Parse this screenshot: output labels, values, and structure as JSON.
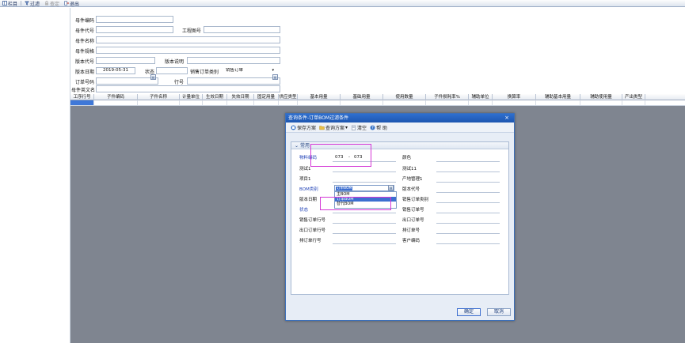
{
  "toolbar": {
    "items": [
      {
        "label": "栏目",
        "icon": "columns-icon"
      },
      {
        "label": "过滤",
        "icon": "filter-icon"
      },
      {
        "label": "查定",
        "icon": "lock-icon",
        "disabled": true
      },
      {
        "label": "退出",
        "icon": "exit-icon"
      }
    ]
  },
  "form": {
    "parent_code_label": "母件编码",
    "parent_alias_label": "母件代号",
    "drawing_no_label": "工程图号",
    "parent_name_label": "母件名称",
    "parent_spec_label": "母件规格",
    "version_code_label": "版本代号",
    "version_desc_label": "版本说明",
    "version_date_label": "版本日期",
    "version_date_value": "2019-05-31",
    "status_label": "状态",
    "sales_order_type_label": "销售订单类别",
    "sales_order_type_value": "销售订单",
    "order_no_label": "订单号码",
    "line_no_label": "行号",
    "parent_en_name_label": "母件英文名"
  },
  "grid": {
    "columns": [
      "工序行号",
      "子件编码",
      "子件名称",
      "计量单位",
      "生效日期",
      "失效日期",
      "固定用量",
      "供应类型",
      "基本用量",
      "基础用量",
      "使用数量",
      "子件损耗率%",
      "辅助单位",
      "换算率",
      "辅助基本用量",
      "辅助使用量",
      "产出类型"
    ]
  },
  "dialog": {
    "title": "查询条件-订单BOM过滤条件",
    "close": "×",
    "toolbar": {
      "save_scheme": "保存方案",
      "query_scheme": "查询方案",
      "clear": "清空",
      "help": "帮 助"
    },
    "section": "常用",
    "fields": {
      "material_code_label": "物料编码",
      "material_code_from": "073",
      "range_sep": "-",
      "material_code_to": "073",
      "color_label": "颜色",
      "test1_label": "测试1",
      "test11_label": "测试11",
      "item1_label": "项目1",
      "prod_mgmt_label": "产地管理1",
      "bom_type_label": "BOM类别",
      "bom_type_value": "订单BOM",
      "version_code_label": "版本代号",
      "version_date_label": "版本日期",
      "sales_order_type_label": "销售订单类别",
      "status_label": "状态",
      "sales_order_no_label": "销售订单号",
      "sales_order_line_label": "销售订单行号",
      "export_order_no_label": "出口订单号",
      "export_order_line_label": "出口订单行号",
      "mto_no_label": "排订单号",
      "mto_line_label": "排订单行号",
      "customer_code_label": "客户编码"
    },
    "dropdown_options": [
      "主BOM",
      "订单BOM",
      "替代BOM"
    ],
    "ok": "确定",
    "cancel": "取消"
  },
  "colors": {
    "dialog_title": "#2f6fcf",
    "highlight_box": "#d436d6",
    "selection": "#3d6fd0",
    "grid_body": "#7f8590"
  }
}
